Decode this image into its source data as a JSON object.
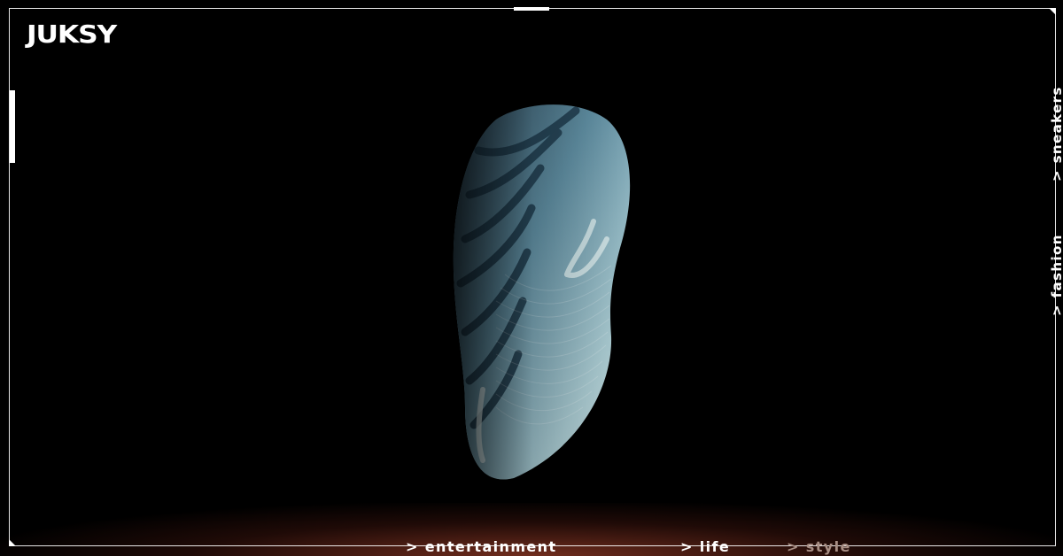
{
  "brand": {
    "logo": "JUKSY"
  },
  "hero": {
    "image_subject": "sneaker-sole-image"
  },
  "bottom_nav": {
    "items": [
      {
        "label": "> entertainment"
      },
      {
        "label": "> life"
      },
      {
        "label": "> style"
      }
    ]
  },
  "side_nav": {
    "items": [
      {
        "label": "> sneakers"
      },
      {
        "label": "> fashion"
      }
    ]
  },
  "colors": {
    "background": "#000000",
    "frame": "#ffffff",
    "glow": "#96402a",
    "dim_text": "#a98f85"
  }
}
